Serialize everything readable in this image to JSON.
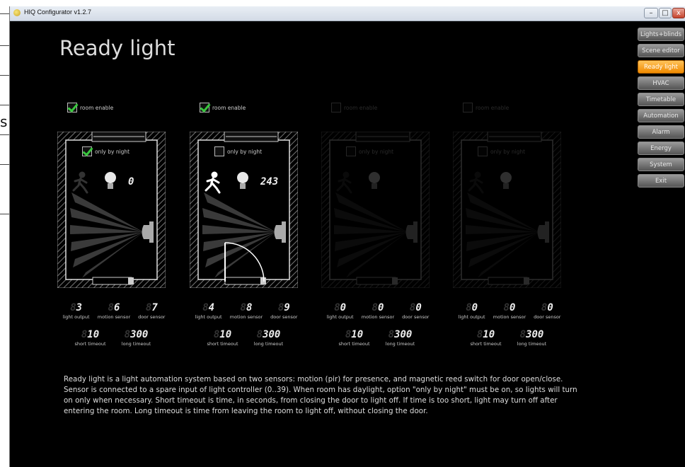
{
  "window": {
    "title": "HIQ Configurator v1.2.7"
  },
  "background_letter": "s",
  "page_title": "Ready light",
  "menu": [
    {
      "label": "Lights+blinds",
      "active": false
    },
    {
      "label": "Scene editor",
      "active": false
    },
    {
      "label": "Ready light",
      "active": true
    },
    {
      "label": "HVAC",
      "active": false
    },
    {
      "label": "Timetable",
      "active": false
    },
    {
      "label": "Automation",
      "active": false
    },
    {
      "label": "Alarm",
      "active": false
    },
    {
      "label": "Energy",
      "active": false
    },
    {
      "label": "System",
      "active": false
    },
    {
      "label": "Exit",
      "active": false
    }
  ],
  "labels": {
    "room_enable": "room enable",
    "only_by_night": "only by night",
    "light_output": "light output",
    "motion_sensor": "motion sensor",
    "door_sensor": "door sensor",
    "short_timeout": "short timeout",
    "long_timeout": "long timeout"
  },
  "rooms": [
    {
      "enabled": true,
      "only_by_night": true,
      "display": "0",
      "light_output": "3",
      "motion_sensor": "6",
      "door_sensor": "7",
      "short_timeout": "10",
      "long_timeout": "300",
      "door_open": false
    },
    {
      "enabled": true,
      "only_by_night": false,
      "display": "243",
      "light_output": "4",
      "motion_sensor": "8",
      "door_sensor": "9",
      "short_timeout": "10",
      "long_timeout": "300",
      "door_open": true
    },
    {
      "enabled": false,
      "only_by_night": false,
      "display": "",
      "light_output": "0",
      "motion_sensor": "0",
      "door_sensor": "0",
      "short_timeout": "10",
      "long_timeout": "300",
      "door_open": false
    },
    {
      "enabled": false,
      "only_by_night": false,
      "display": "",
      "light_output": "0",
      "motion_sensor": "0",
      "door_sensor": "0",
      "short_timeout": "10",
      "long_timeout": "300",
      "door_open": false
    }
  ],
  "description": "Ready light is a light automation system based on two sensors: motion (pir) for presence, and magnetic reed switch for door open/close. Sensor is connected to a spare input of light controller (0..39). When room has daylight, option \"only by night\" must be on, so lights will turn on only when necessary. Short timeout is time, in seconds, from closing the door to light off. If time is too short, light may turn off after entering the room. Long timeout is time from leaving the room to light off, without closing the door.",
  "icons": {
    "app": "app-icon",
    "minimize": "minimize-icon",
    "maximize": "maximize-icon",
    "close": "close-icon",
    "person": "person-icon",
    "bulb": "lightbulb-icon",
    "pir": "motion-sensor-icon",
    "door": "door-icon"
  }
}
